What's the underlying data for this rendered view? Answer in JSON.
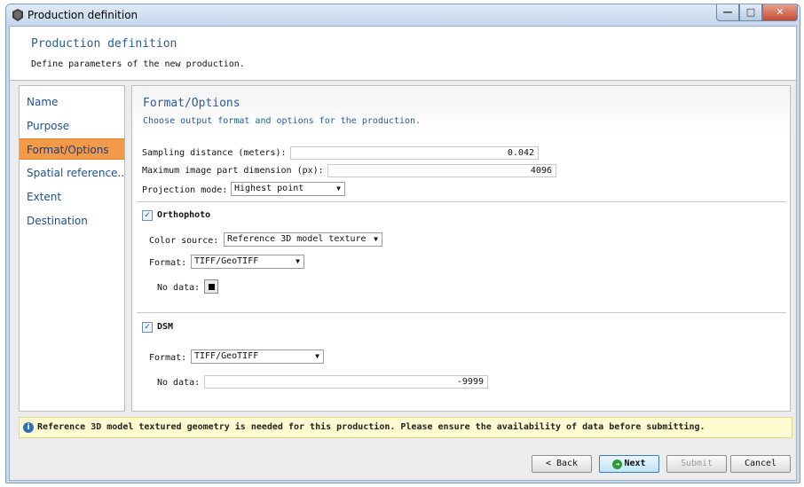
{
  "window": {
    "title": "Production definition",
    "controls": {
      "minimize": "—",
      "maximize": "□",
      "close": "✕"
    },
    "app_icon": "gear-icon"
  },
  "header": {
    "title": "Production definition",
    "subtitle": "Define parameters of the new production."
  },
  "sidebar": {
    "items": [
      {
        "label": "Name"
      },
      {
        "label": "Purpose"
      },
      {
        "label": "Format/Options"
      },
      {
        "label": "Spatial reference..."
      },
      {
        "label": "Extent"
      },
      {
        "label": "Destination"
      }
    ],
    "active": "Format/Options"
  },
  "panel": {
    "title": "Format/Options",
    "subtitle": "Choose output format and options for the production.",
    "sampling": {
      "label": "Sampling distance (meters):",
      "value": "0.042"
    },
    "max_part": {
      "label": "Maximum image part dimension (px):",
      "value": "4096"
    },
    "projection": {
      "label": "Projection mode:",
      "value": "Highest point"
    },
    "orthophoto": {
      "label": "Orthophoto",
      "checked": true,
      "color_source_label": "Color source:",
      "color_source_value": "Reference 3D model texture",
      "format_label": "Format:",
      "format_value": "TIFF/GeoTIFF",
      "nodata_label": "No data:",
      "nodata_color": "#000000"
    },
    "dsm": {
      "label": "DSM",
      "checked": true,
      "format_label": "Format:",
      "format_value": "TIFF/GeoTIFF",
      "nodata_label": "No data:",
      "nodata_value": "-9999"
    }
  },
  "info": {
    "icon": "info-icon",
    "text": "Reference 3D model textured geometry is needed for this production. Please ensure the availability of data before submitting."
  },
  "buttons": {
    "back": "< Back",
    "next": "Next",
    "submit": "Submit",
    "cancel": "Cancel"
  },
  "colors": {
    "accent_active": "#f39a4a",
    "link_blue": "#2a5b9a",
    "info_bg": "#fffbd0"
  }
}
